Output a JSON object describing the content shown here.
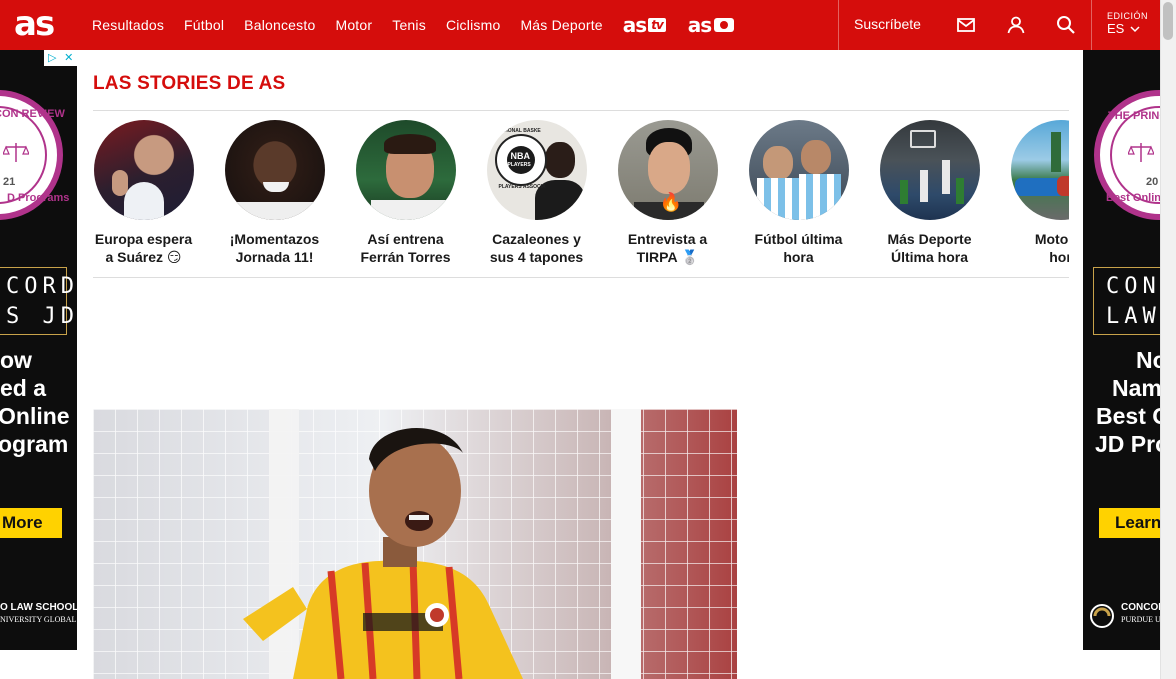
{
  "header": {
    "logo": "as",
    "nav": [
      "Resultados",
      "Fútbol",
      "Baloncesto",
      "Motor",
      "Tenis",
      "Ciclismo",
      "Más Deporte"
    ],
    "brand_tv": {
      "text": "as",
      "suffix": "tv"
    },
    "brand_photo": {
      "text": "as"
    },
    "subscribe": "Suscríbete",
    "edition_label": "EDICIÓN",
    "edition_value": "ES"
  },
  "stories": {
    "title": "LAS STORIES DE AS",
    "items": [
      {
        "line1": "Europa espera",
        "line2": "a Suárez 😏"
      },
      {
        "line1": "¡Momentazos",
        "line2": "Jornada 11!"
      },
      {
        "line1": "Así entrena",
        "line2": "Ferrán Torres"
      },
      {
        "line1": "Cazaleones y",
        "line2": "sus 4 tapones"
      },
      {
        "line1": "Entrevista a",
        "line2": "TIRPA 🥈"
      },
      {
        "line1": "Fútbol última",
        "line2": "hora"
      },
      {
        "line1": "Más Deporte",
        "line2": "Última hora"
      },
      {
        "line1": "Motor ú",
        "line2": "hor"
      }
    ],
    "nba_badge": [
      "NATIONAL BASKE",
      "NBA",
      "PLAYERS",
      "PLAYERS ASSOCIA"
    ]
  },
  "ad_left": {
    "badge": [
      "▷",
      "✕"
    ],
    "seal_top": "CON REVIEW",
    "seal_mid": "21",
    "seal_bottom": "D Programs",
    "box_line1": "CORD",
    "box_line2": "S JD",
    "headline": [
      "ow",
      "ed a",
      "Online",
      "ogram"
    ],
    "cta": "More",
    "foot_line1": "O LAW SCHOOL",
    "foot_line2": "NIVERSITY GLOBAL"
  },
  "ad_right": {
    "seal_top": "THE PRINCET",
    "seal_mid": "20",
    "seal_bottom": "Best Online J",
    "box_line1": "CONC",
    "box_line2": "LAW'",
    "headline": [
      "No",
      "Nam",
      "Best O",
      "JD Pro"
    ],
    "cta": "Learn",
    "foot_line1": "CONCOR",
    "foot_line2": "PURDUE U"
  },
  "colors": {
    "brand_red": "#d50d0c",
    "ad_magenta": "#b0338b",
    "ad_yellow": "#ffd200",
    "ad_gold": "#c8a24a"
  }
}
